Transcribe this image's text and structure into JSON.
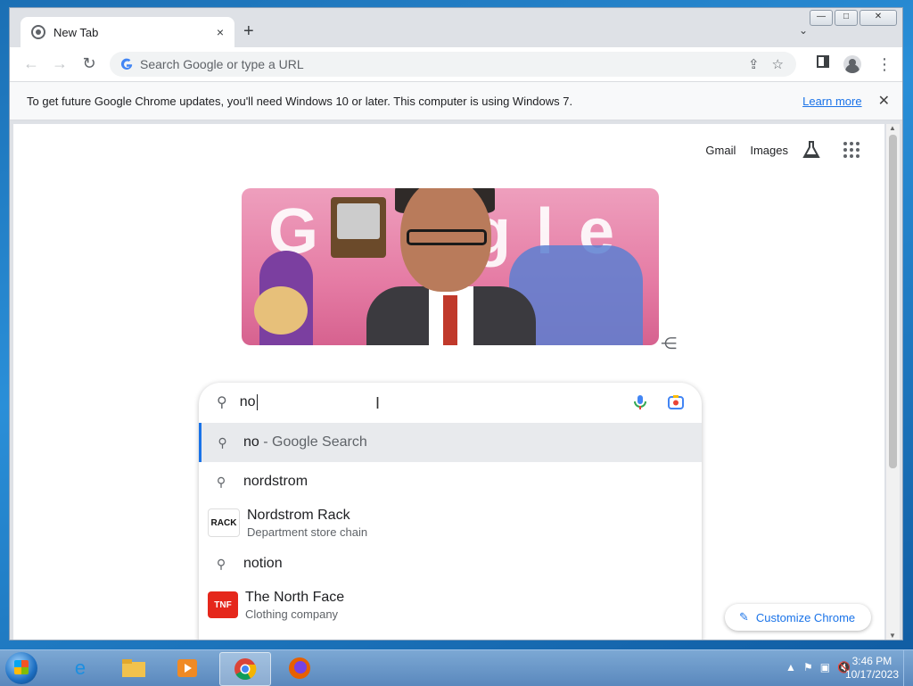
{
  "browser": {
    "tab": {
      "title": "New Tab",
      "close": "×"
    },
    "new_tab": "+",
    "tab_search": "⌄",
    "window_controls": {
      "minimize": "—",
      "maximize": "□",
      "close": "✕"
    },
    "nav": {
      "back": "←",
      "forward": "→",
      "reload": "↻"
    },
    "omnibox": {
      "placeholder": "Search Google or type a URL",
      "share": "⇪",
      "bookmark": "☆"
    },
    "infobar": {
      "message": "To get future Google Chrome updates, you'll need Windows 10 or later. This computer is using Windows 7.",
      "link": "Learn more",
      "close": "✕"
    }
  },
  "page": {
    "top_links": {
      "gmail": "Gmail",
      "images": "Images"
    },
    "doodle": {
      "letters": "Google"
    },
    "search": {
      "query": "no",
      "suggestions": [
        {
          "type": "query",
          "text": "no",
          "suffix": " - Google Search",
          "selected": true
        },
        {
          "type": "query",
          "text": "nordstrom"
        },
        {
          "type": "entity",
          "title": "Nordstrom Rack",
          "subtitle": "Department store chain",
          "thumb": "RACK"
        },
        {
          "type": "query",
          "text": "notion"
        },
        {
          "type": "entity",
          "title": "The North Face",
          "subtitle": "Clothing company",
          "thumb": "TNF"
        }
      ]
    },
    "customize": {
      "label": "Customize Chrome",
      "icon": "pencil-icon"
    }
  },
  "taskbar": {
    "apps": [
      "internet-explorer",
      "file-explorer",
      "media-player",
      "chrome",
      "firefox"
    ],
    "active_app": "chrome",
    "clock": {
      "time": "3:46 PM",
      "date": "10/17/2023"
    },
    "tray": {
      "up": "▲",
      "flag": "⚑",
      "network": "▣",
      "volume": "🔇"
    }
  },
  "colors": {
    "accent": "#1a73e8",
    "tab_bg": "#dee1e6",
    "omnibox_bg": "#f1f3f4",
    "selected_row": "#e8eaed"
  }
}
